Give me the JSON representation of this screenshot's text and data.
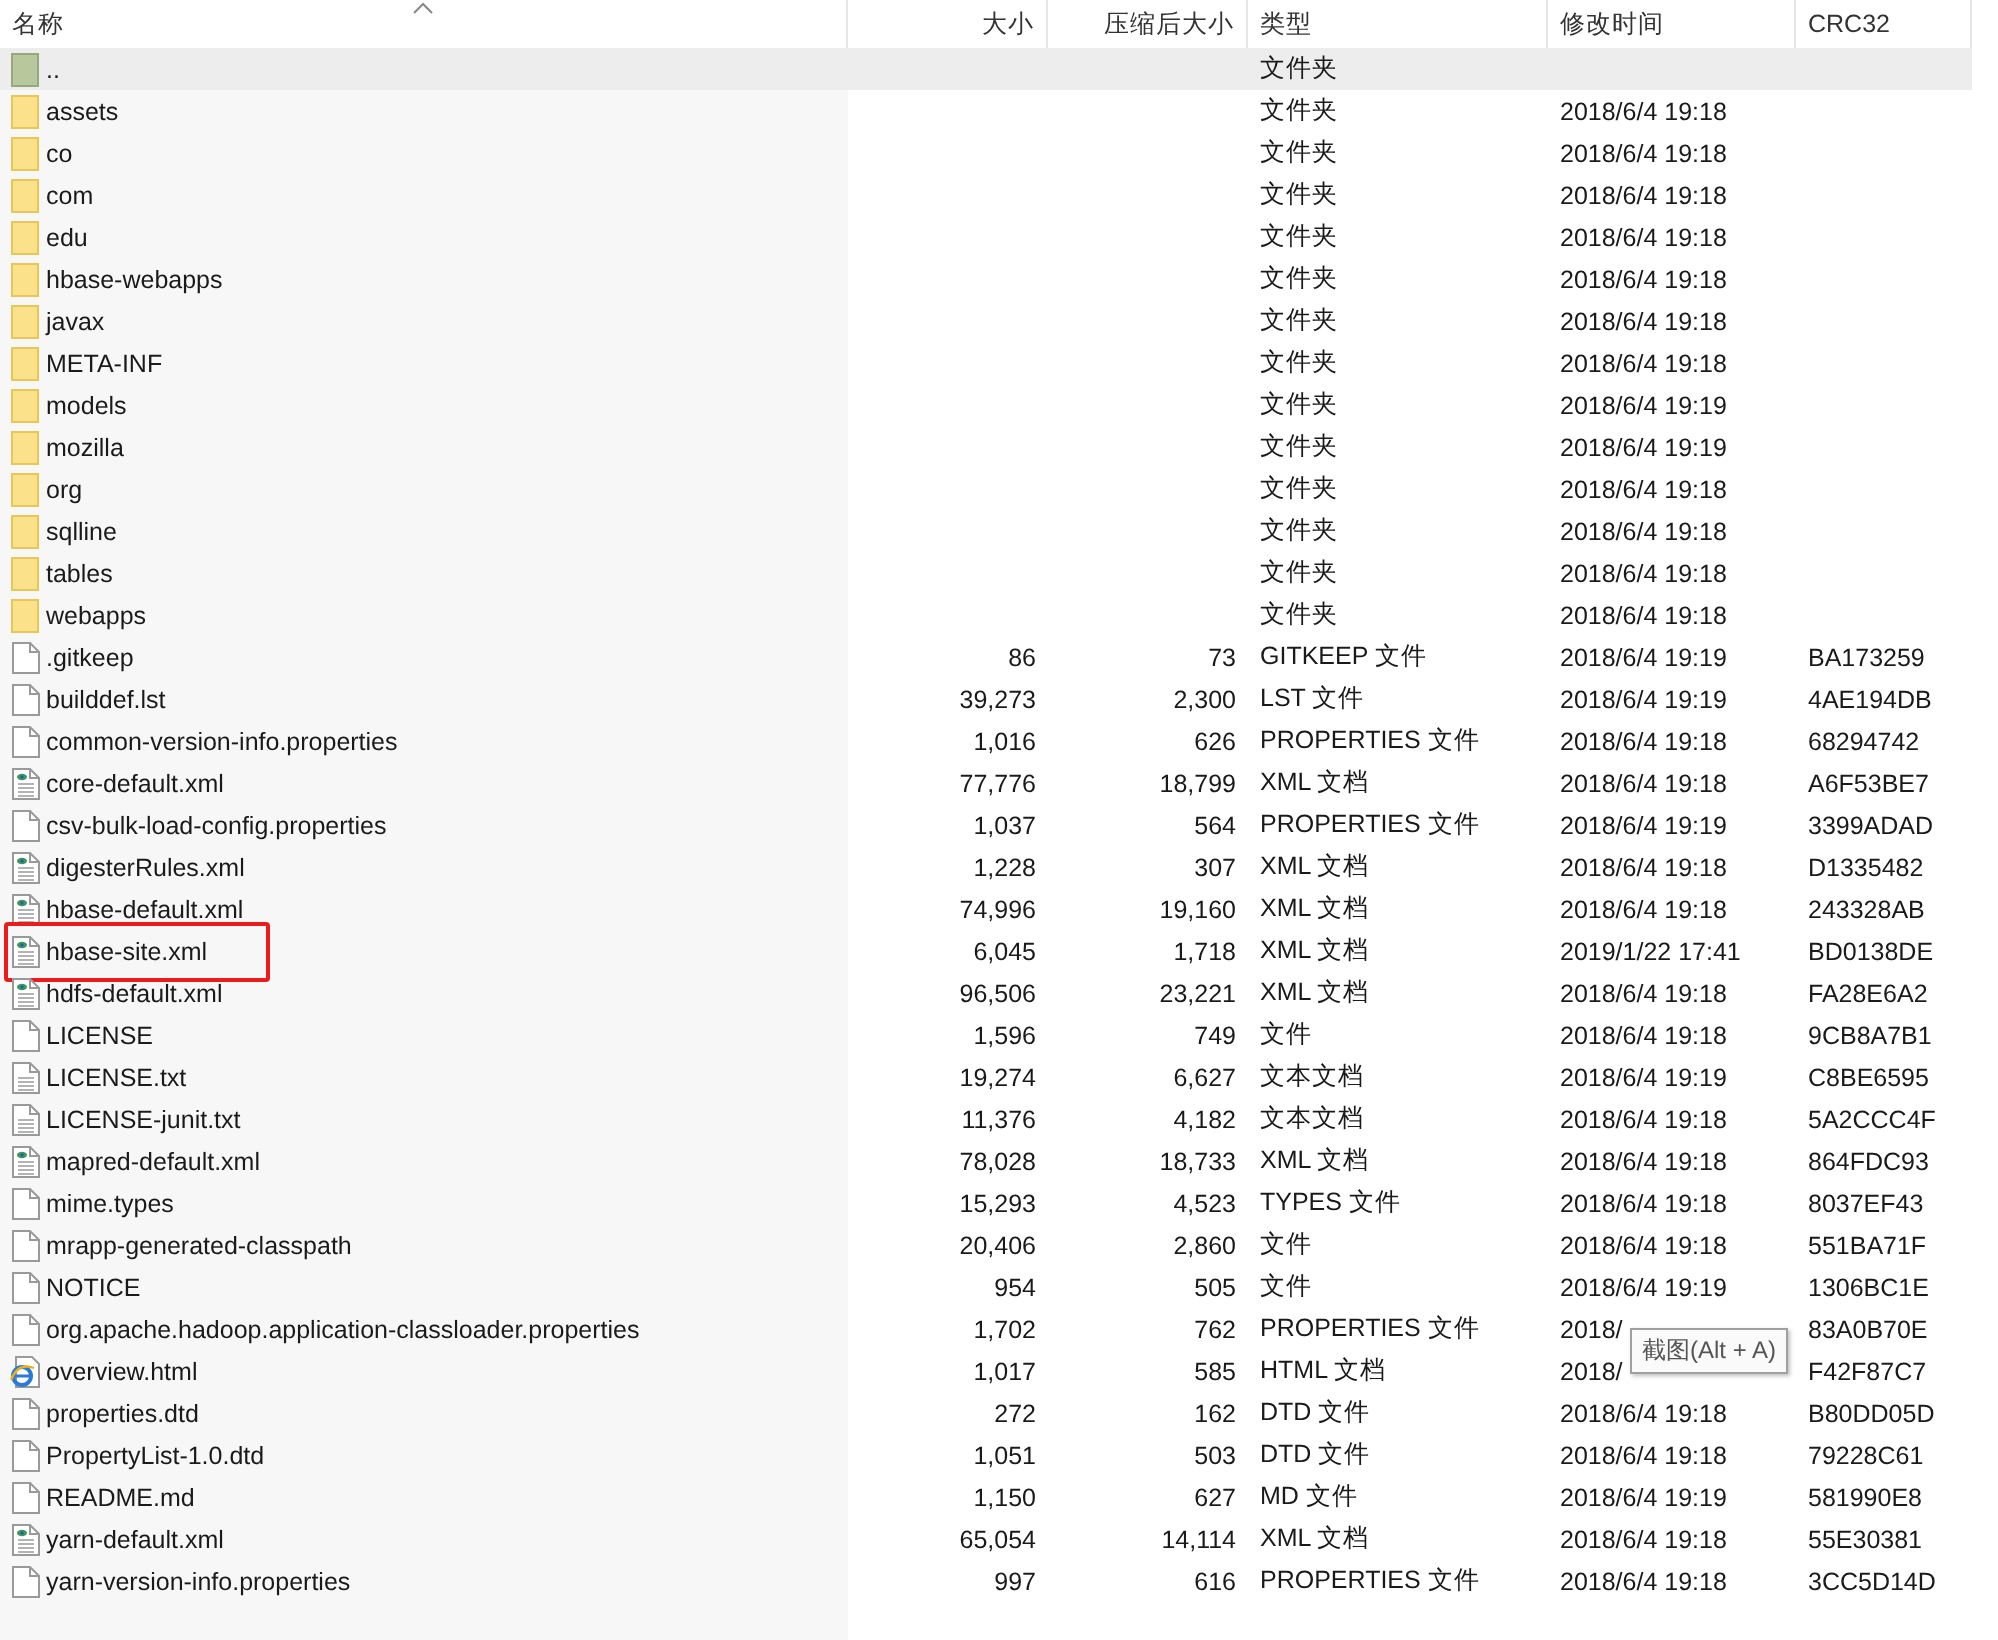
{
  "columns": [
    "名称",
    "大小",
    "压缩后大小",
    "类型",
    "修改时间",
    "CRC32"
  ],
  "rows": [
    {
      "kind": "parent",
      "name": "..",
      "size": "",
      "packed": "",
      "type": "文件夹",
      "modified": "",
      "crc": "",
      "selected": true,
      "highlighted": false
    },
    {
      "kind": "folder",
      "name": "assets",
      "size": "",
      "packed": "",
      "type": "文件夹",
      "modified": "2018/6/4 19:18",
      "crc": "",
      "selected": false,
      "highlighted": false
    },
    {
      "kind": "folder",
      "name": "co",
      "size": "",
      "packed": "",
      "type": "文件夹",
      "modified": "2018/6/4 19:18",
      "crc": "",
      "selected": false,
      "highlighted": false
    },
    {
      "kind": "folder",
      "name": "com",
      "size": "",
      "packed": "",
      "type": "文件夹",
      "modified": "2018/6/4 19:18",
      "crc": "",
      "selected": false,
      "highlighted": false
    },
    {
      "kind": "folder",
      "name": "edu",
      "size": "",
      "packed": "",
      "type": "文件夹",
      "modified": "2018/6/4 19:18",
      "crc": "",
      "selected": false,
      "highlighted": false
    },
    {
      "kind": "folder",
      "name": "hbase-webapps",
      "size": "",
      "packed": "",
      "type": "文件夹",
      "modified": "2018/6/4 19:18",
      "crc": "",
      "selected": false,
      "highlighted": false
    },
    {
      "kind": "folder",
      "name": "javax",
      "size": "",
      "packed": "",
      "type": "文件夹",
      "modified": "2018/6/4 19:18",
      "crc": "",
      "selected": false,
      "highlighted": false
    },
    {
      "kind": "folder",
      "name": "META-INF",
      "size": "",
      "packed": "",
      "type": "文件夹",
      "modified": "2018/6/4 19:18",
      "crc": "",
      "selected": false,
      "highlighted": false
    },
    {
      "kind": "folder",
      "name": "models",
      "size": "",
      "packed": "",
      "type": "文件夹",
      "modified": "2018/6/4 19:19",
      "crc": "",
      "selected": false,
      "highlighted": false
    },
    {
      "kind": "folder",
      "name": "mozilla",
      "size": "",
      "packed": "",
      "type": "文件夹",
      "modified": "2018/6/4 19:19",
      "crc": "",
      "selected": false,
      "highlighted": false
    },
    {
      "kind": "folder",
      "name": "org",
      "size": "",
      "packed": "",
      "type": "文件夹",
      "modified": "2018/6/4 19:18",
      "crc": "",
      "selected": false,
      "highlighted": false
    },
    {
      "kind": "folder",
      "name": "sqlline",
      "size": "",
      "packed": "",
      "type": "文件夹",
      "modified": "2018/6/4 19:18",
      "crc": "",
      "selected": false,
      "highlighted": false
    },
    {
      "kind": "folder",
      "name": "tables",
      "size": "",
      "packed": "",
      "type": "文件夹",
      "modified": "2018/6/4 19:18",
      "crc": "",
      "selected": false,
      "highlighted": false
    },
    {
      "kind": "folder",
      "name": "webapps",
      "size": "",
      "packed": "",
      "type": "文件夹",
      "modified": "2018/6/4 19:18",
      "crc": "",
      "selected": false,
      "highlighted": false
    },
    {
      "kind": "file",
      "name": ".gitkeep",
      "size": "86",
      "packed": "73",
      "type": "GITKEEP 文件",
      "modified": "2018/6/4 19:19",
      "crc": "BA173259",
      "selected": false,
      "highlighted": false
    },
    {
      "kind": "file",
      "name": "builddef.lst",
      "size": "39,273",
      "packed": "2,300",
      "type": "LST 文件",
      "modified": "2018/6/4 19:19",
      "crc": "4AE194DB",
      "selected": false,
      "highlighted": false
    },
    {
      "kind": "file",
      "name": "common-version-info.properties",
      "size": "1,016",
      "packed": "626",
      "type": "PROPERTIES 文件",
      "modified": "2018/6/4 19:18",
      "crc": "68294742",
      "selected": false,
      "highlighted": false
    },
    {
      "kind": "xml",
      "name": "core-default.xml",
      "size": "77,776",
      "packed": "18,799",
      "type": "XML 文档",
      "modified": "2018/6/4 19:18",
      "crc": "A6F53BE7",
      "selected": false,
      "highlighted": false
    },
    {
      "kind": "file",
      "name": "csv-bulk-load-config.properties",
      "size": "1,037",
      "packed": "564",
      "type": "PROPERTIES 文件",
      "modified": "2018/6/4 19:19",
      "crc": "3399ADAD",
      "selected": false,
      "highlighted": false
    },
    {
      "kind": "xml",
      "name": "digesterRules.xml",
      "size": "1,228",
      "packed": "307",
      "type": "XML 文档",
      "modified": "2018/6/4 19:18",
      "crc": "D1335482",
      "selected": false,
      "highlighted": false
    },
    {
      "kind": "xml",
      "name": "hbase-default.xml",
      "size": "74,996",
      "packed": "19,160",
      "type": "XML 文档",
      "modified": "2018/6/4 19:18",
      "crc": "243328AB",
      "selected": false,
      "highlighted": false
    },
    {
      "kind": "xml",
      "name": "hbase-site.xml",
      "size": "6,045",
      "packed": "1,718",
      "type": "XML 文档",
      "modified": "2019/1/22 17:41",
      "crc": "BD0138DE",
      "selected": false,
      "highlighted": true
    },
    {
      "kind": "xml",
      "name": "hdfs-default.xml",
      "size": "96,506",
      "packed": "23,221",
      "type": "XML 文档",
      "modified": "2018/6/4 19:18",
      "crc": "FA28E6A2",
      "selected": false,
      "highlighted": false
    },
    {
      "kind": "file",
      "name": "LICENSE",
      "size": "1,596",
      "packed": "749",
      "type": "文件",
      "modified": "2018/6/4 19:18",
      "crc": "9CB8A7B1",
      "selected": false,
      "highlighted": false
    },
    {
      "kind": "text",
      "name": "LICENSE.txt",
      "size": "19,274",
      "packed": "6,627",
      "type": "文本文档",
      "modified": "2018/6/4 19:19",
      "crc": "C8BE6595",
      "selected": false,
      "highlighted": false
    },
    {
      "kind": "text",
      "name": "LICENSE-junit.txt",
      "size": "11,376",
      "packed": "4,182",
      "type": "文本文档",
      "modified": "2018/6/4 19:18",
      "crc": "5A2CCC4F",
      "selected": false,
      "highlighted": false
    },
    {
      "kind": "xml",
      "name": "mapred-default.xml",
      "size": "78,028",
      "packed": "18,733",
      "type": "XML 文档",
      "modified": "2018/6/4 19:18",
      "crc": "864FDC93",
      "selected": false,
      "highlighted": false
    },
    {
      "kind": "file",
      "name": "mime.types",
      "size": "15,293",
      "packed": "4,523",
      "type": "TYPES 文件",
      "modified": "2018/6/4 19:18",
      "crc": "8037EF43",
      "selected": false,
      "highlighted": false
    },
    {
      "kind": "file",
      "name": "mrapp-generated-classpath",
      "size": "20,406",
      "packed": "2,860",
      "type": "文件",
      "modified": "2018/6/4 19:18",
      "crc": "551BA71F",
      "selected": false,
      "highlighted": false
    },
    {
      "kind": "file",
      "name": "NOTICE",
      "size": "954",
      "packed": "505",
      "type": "文件",
      "modified": "2018/6/4 19:19",
      "crc": "1306BC1E",
      "selected": false,
      "highlighted": false
    },
    {
      "kind": "file",
      "name": "org.apache.hadoop.application-classloader.properties",
      "size": "1,702",
      "packed": "762",
      "type": "PROPERTIES 文件",
      "modified": "2018/",
      "crc": "83A0B70E",
      "selected": false,
      "highlighted": false
    },
    {
      "kind": "html",
      "name": "overview.html",
      "size": "1,017",
      "packed": "585",
      "type": "HTML 文档",
      "modified": "2018/",
      "crc": "F42F87C7",
      "selected": false,
      "highlighted": false
    },
    {
      "kind": "file",
      "name": "properties.dtd",
      "size": "272",
      "packed": "162",
      "type": "DTD 文件",
      "modified": "2018/6/4 19:18",
      "crc": "B80DD05D",
      "selected": false,
      "highlighted": false
    },
    {
      "kind": "file",
      "name": "PropertyList-1.0.dtd",
      "size": "1,051",
      "packed": "503",
      "type": "DTD 文件",
      "modified": "2018/6/4 19:18",
      "crc": "79228C61",
      "selected": false,
      "highlighted": false
    },
    {
      "kind": "file",
      "name": "README.md",
      "size": "1,150",
      "packed": "627",
      "type": "MD 文件",
      "modified": "2018/6/4 19:19",
      "crc": "581990E8",
      "selected": false,
      "highlighted": false
    },
    {
      "kind": "xml",
      "name": "yarn-default.xml",
      "size": "65,054",
      "packed": "14,114",
      "type": "XML 文档",
      "modified": "2018/6/4 19:18",
      "crc": "55E30381",
      "selected": false,
      "highlighted": false
    },
    {
      "kind": "file",
      "name": "yarn-version-info.properties",
      "size": "997",
      "packed": "616",
      "type": "PROPERTIES 文件",
      "modified": "2018/6/4 19:18",
      "crc": "3CC5D14D",
      "selected": false,
      "highlighted": false
    }
  ],
  "tooltip": {
    "text": "截图(Alt + A)"
  }
}
